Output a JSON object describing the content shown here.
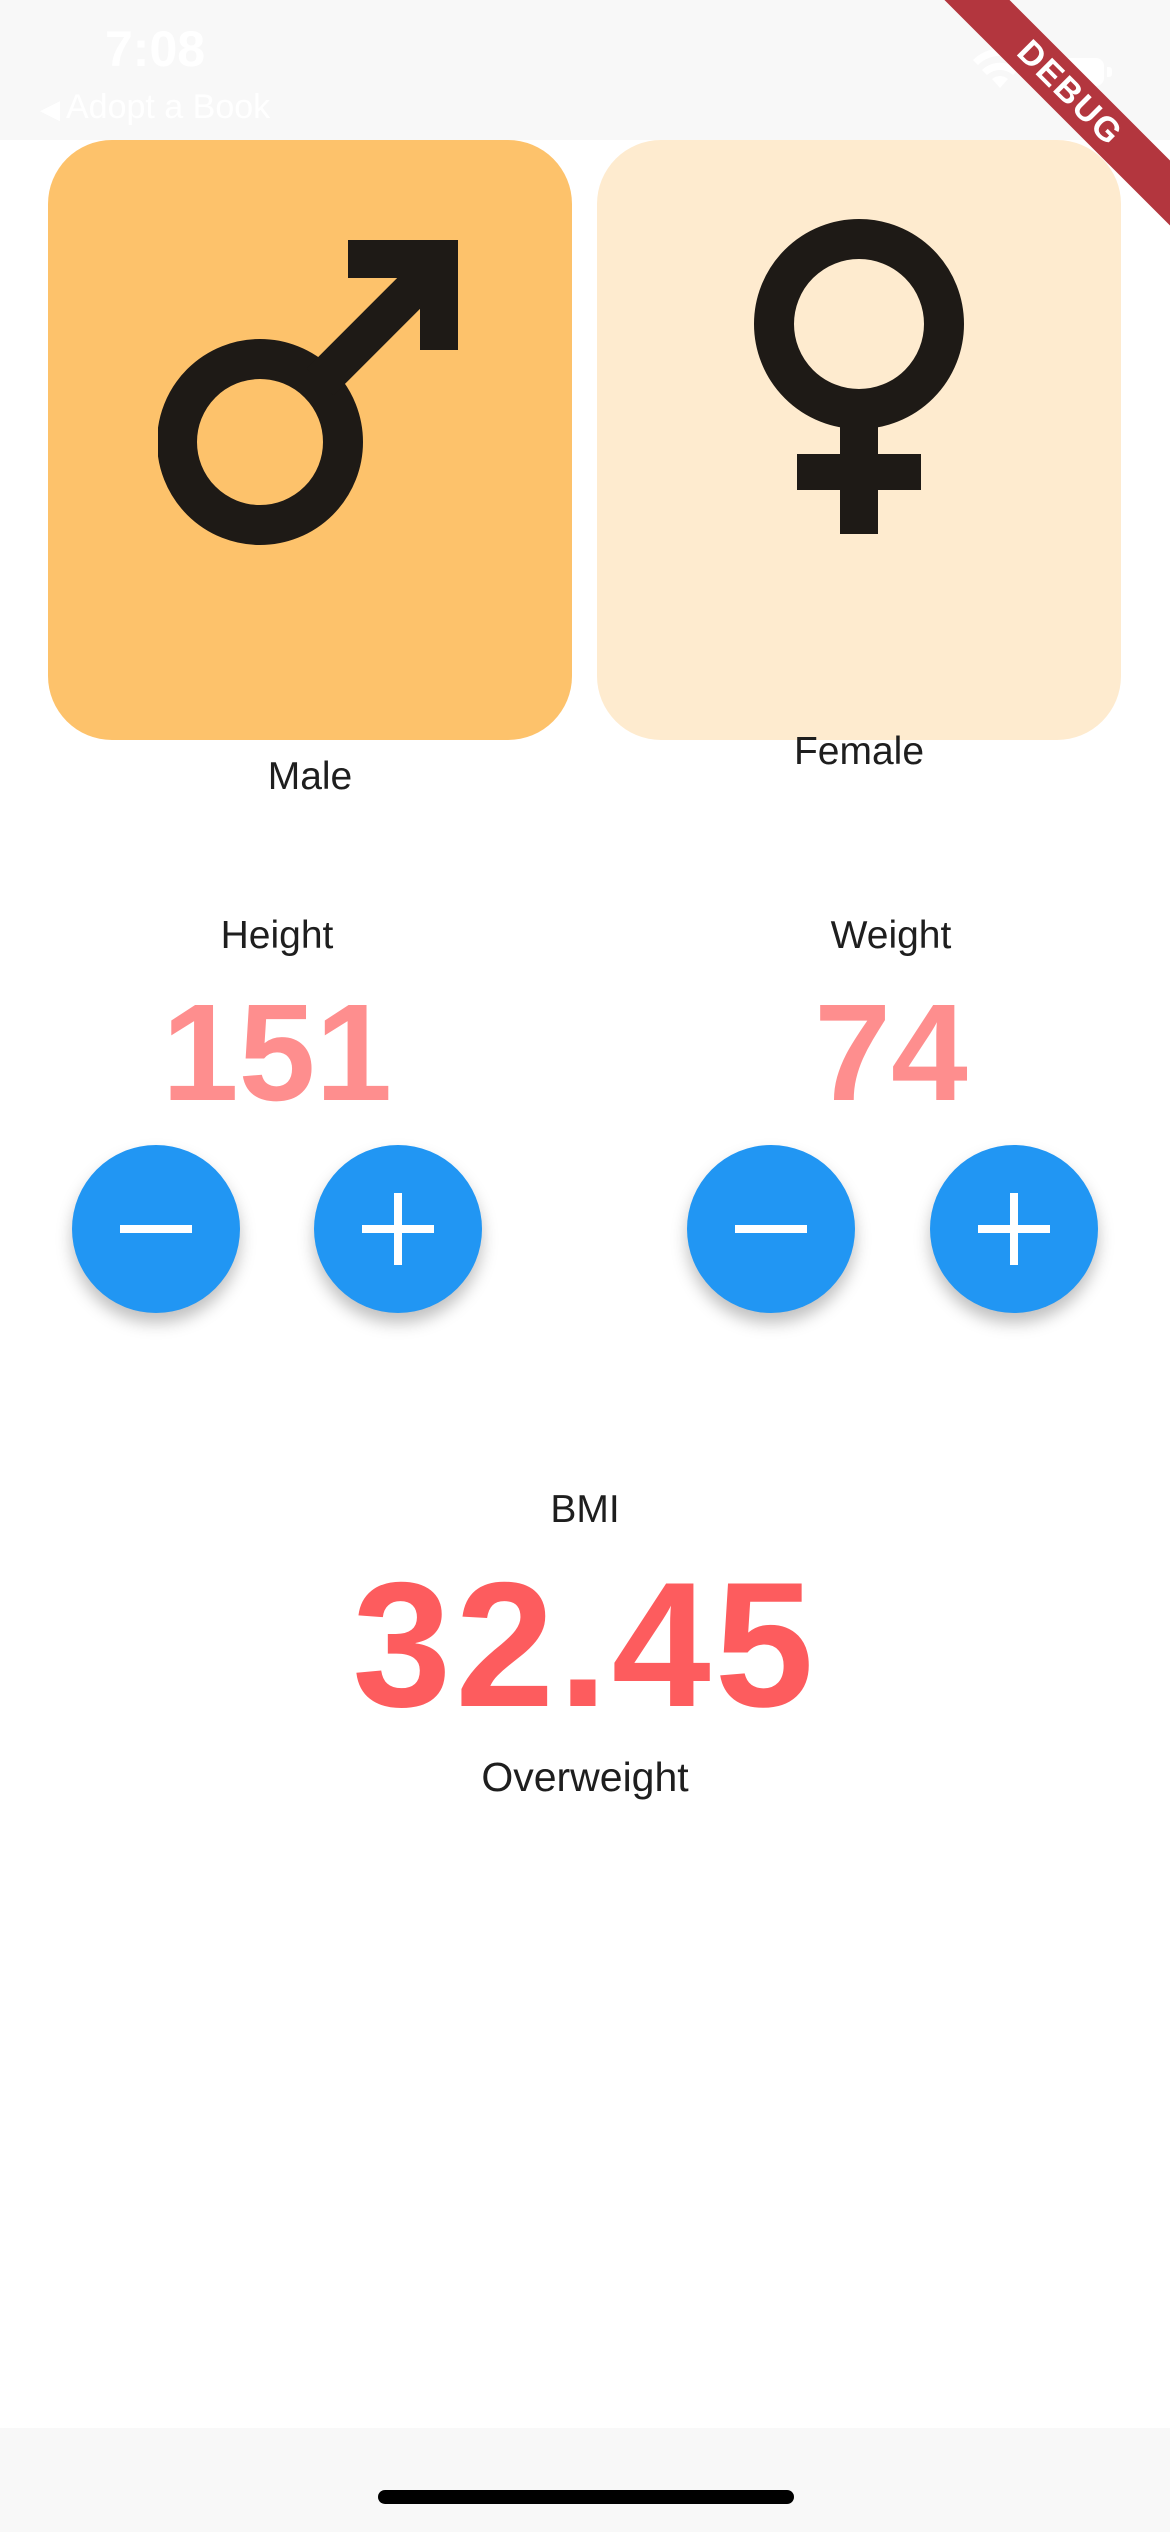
{
  "status_bar": {
    "time": "7:08",
    "back_app": "Adopt a Book",
    "debug_label": "DEBUG"
  },
  "gender": {
    "male": {
      "label": "Male",
      "icon": "male-symbol-icon",
      "selected": true
    },
    "female": {
      "label": "Female",
      "icon": "female-symbol-icon",
      "selected": false
    }
  },
  "height": {
    "title": "Height",
    "value": "151"
  },
  "weight": {
    "title": "Weight",
    "value": "74"
  },
  "bmi": {
    "title": "BMI",
    "value": "32.45",
    "category": "Overweight"
  },
  "colors": {
    "selected_card": "#fdc26b",
    "unselected_card": "#feebcf",
    "metric_value": "#fe8e8e",
    "bmi_value": "#fd5c5e",
    "button": "#2196f3",
    "debug_ribbon": "#b3363e"
  }
}
